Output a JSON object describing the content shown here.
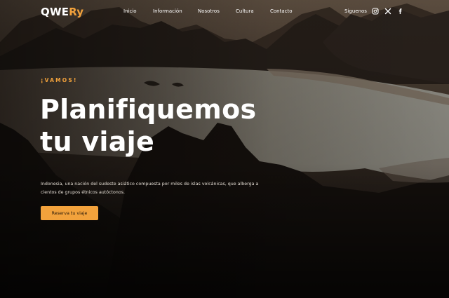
{
  "brand": {
    "logo_part1": "QWE",
    "logo_part2": "Ry"
  },
  "nav": {
    "items": [
      {
        "label": "Inicio"
      },
      {
        "label": "Información"
      },
      {
        "label": "Nosotros"
      },
      {
        "label": "Cultura"
      },
      {
        "label": "Contacto"
      }
    ],
    "social_label": "Siguenos",
    "social_icons": [
      "instagram-icon",
      "x-twitter-icon",
      "facebook-icon"
    ]
  },
  "hero": {
    "eyebrow": "¡VAMOS!",
    "title_line1": "Planifiquemos",
    "title_line2": "tu viaje",
    "description": "Indonesia, una nación del sudeste asiático compuesta por miles de islas volcánicas, que alberga a cientos de grupos étnicos autóctonos.",
    "cta_label": "Reserva tu viaje"
  },
  "colors": {
    "accent": "#f2a23c",
    "text": "#ffffff",
    "background_dark": "#171310"
  }
}
